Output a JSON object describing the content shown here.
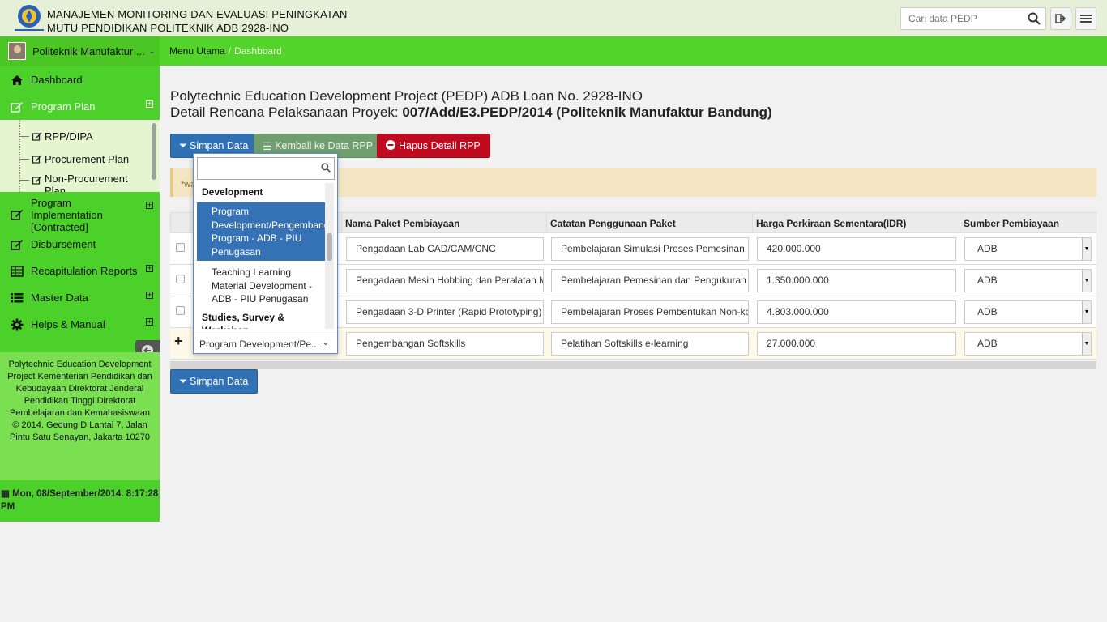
{
  "header": {
    "title_line1": "MANAJEMEN MONITORING DAN EVALUASI PENINGKATAN",
    "title_line2": "MUTU PENDIDIKAN POLITEKNIK ADB 2928-INO",
    "search_placeholder": "Cari data PEDP"
  },
  "navbar": {
    "user_name": "Politeknik Manufaktur ...",
    "breadcrumb": [
      "Menu Utama",
      "Dashboard"
    ]
  },
  "sidebar": {
    "items": [
      {
        "label": "Dashboard",
        "icon": "home-icon"
      },
      {
        "label": "Program Plan",
        "icon": "edit-icon"
      },
      {
        "label": "Program Implementation [Contracted]",
        "icon": "edit-icon"
      },
      {
        "label": "Disbursement",
        "icon": "edit-icon"
      },
      {
        "label": "Recapitulation Reports",
        "icon": "table-icon"
      },
      {
        "label": "Master Data",
        "icon": "list-icon"
      },
      {
        "label": "Helps & Manual",
        "icon": "gear-icon"
      }
    ],
    "submenu": [
      "RPP/DIPA",
      "Procurement Plan",
      "Non-Procurement Plan"
    ],
    "footer": "Polytechnic Education Development Project Kementerian Pendidikan dan Kebudayaan Direktorat Jenderal Pendidikan Tinggi Direktorat Pembelajaran dan Kemahasiswaan © 2014. Gedung D Lantai 7, Jalan Pintu Satu Senayan, Jakarta 10270",
    "datetime": "Mon, 08/September/2014. 8:17:28 PM"
  },
  "main": {
    "title_line1": "Polytechnic Education Development Project (PEDP) ADB Loan No. 2928-INO",
    "title_line2_prefix": "Detail Rencana Pelaksanaan Proyek: ",
    "title_line2_bold": "007/Add/E3.PEDP/2014 (Politeknik Manufaktur Bandung)",
    "buttons": {
      "save": "Simpan Data",
      "back": "Kembali ke Data RPP",
      "delete": "Hapus Detail RPP"
    },
    "alert_text": "*wa",
    "columns": [
      "Nama Paket Pembiayaan",
      "Catatan Penggunaan Paket",
      "Harga Perkiraan Sementara(IDR)",
      "Sumber Pembiayaan"
    ],
    "rows": [
      {
        "paket": "Pengadaan Lab CAD/CAM/CNC",
        "catatan": "Pembelajaran Simulasi Proses Pemesinan",
        "harga": "420.000.000",
        "sumber": "ADB"
      },
      {
        "paket": "Pengadaan Mesin Hobbing dan Peralatan Me",
        "catatan": "Pembelajaran Pemesinan dan Pengukuran F",
        "harga": "1.350.000.000",
        "sumber": "ADB"
      },
      {
        "paket": "Pengadaan 3-D Printer (Rapid Prototyping)",
        "catatan": "Pembelajaran Proses Pembentukan Non-ko",
        "harga": "4.803.000.000",
        "sumber": "ADB"
      },
      {
        "paket": "Pengembangan Softskills",
        "catatan": "Pelatihan Softskills e-learning",
        "harga": "27.000.000",
        "sumber": "ADB"
      }
    ]
  },
  "dropdown": {
    "group1": "Development",
    "option_highlighted": "Program Development/Pengembangan Program - ADB - PIU Penugasan",
    "option2": "Teaching Learning Material Development - ADB - PIU Penugasan",
    "group2": "Studies, Survey & Workshop",
    "selected": "Program Development/Pe..."
  },
  "colors": {
    "nav_green": "#53d42a",
    "primary_blue": "#3071b6",
    "danger_red": "#c00a20"
  }
}
